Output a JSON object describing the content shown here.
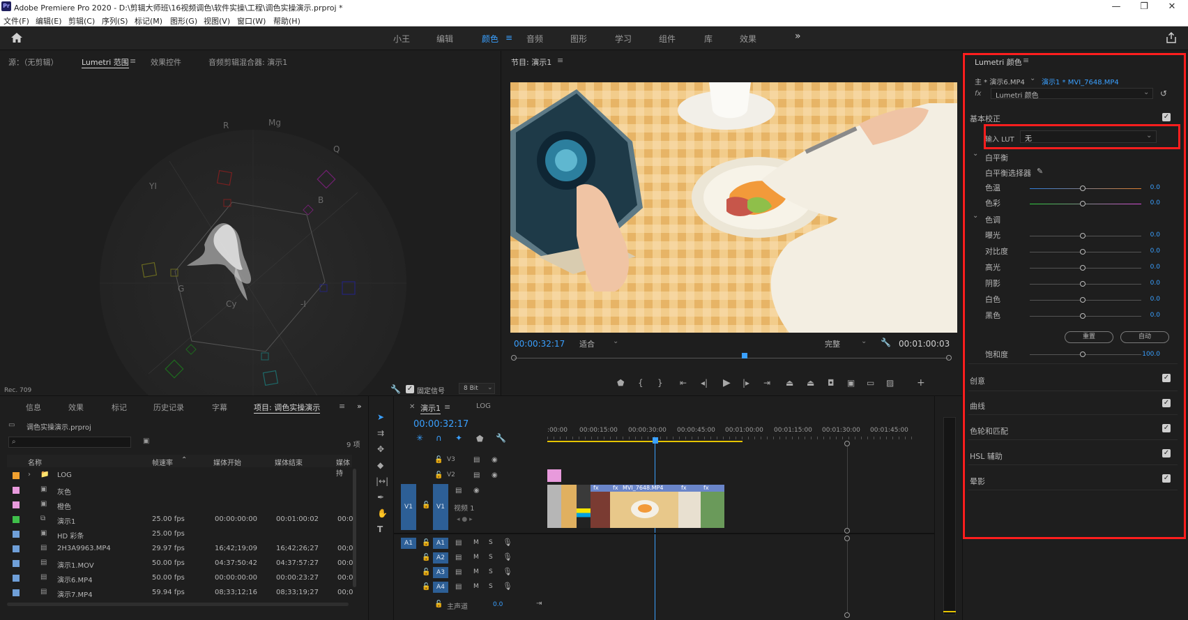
{
  "titlebar": {
    "logo": "Pr",
    "title": "Adobe Premiere Pro 2020 - D:\\剪辑大师班\\16视频调色\\软件实操\\工程\\调色实操演示.prproj *",
    "minimize": "—",
    "restore": "❐",
    "close": "✕"
  },
  "menubar": [
    "文件(F)",
    "编辑(E)",
    "剪辑(C)",
    "序列(S)",
    "标记(M)",
    "图形(G)",
    "视图(V)",
    "窗口(W)",
    "帮助(H)"
  ],
  "workspaces": {
    "items": [
      "小王",
      "编辑",
      "颜色",
      "音频",
      "图形",
      "学习",
      "组件",
      "库",
      "效果"
    ],
    "active": "颜色",
    "more": "»"
  },
  "source_panel": {
    "tabs": [
      "源：（无剪辑）",
      "Lumetri 范围",
      "效果控件",
      "音频剪辑混合器: 演示1"
    ],
    "active_tab": "Lumetri 范围",
    "scope_labels": [
      "R",
      "Mg",
      "Q",
      "YI",
      "B",
      "G",
      "Cy",
      "-I"
    ],
    "rec_label": "Rec. 709",
    "clamp_label": "固定信号",
    "bit_depth": "8 Bit"
  },
  "program_panel": {
    "title": "节目: 演示1",
    "timecode": "00:00:32:17",
    "fit": "适合",
    "quality": "完整",
    "duration": "00:01:00:03",
    "playhead_fraction": 0.53
  },
  "lumetri": {
    "title": "Lumetri 颜色",
    "master": "主 * 演示6.MP4",
    "clip": "演示1 * MVI_7648.MP4",
    "effect": "Lumetri 颜色",
    "basic": {
      "title": "基本校正",
      "lut_label": "输入 LUT",
      "lut_value": "无",
      "white_balance": "白平衡",
      "wb_picker": "白平衡选择器",
      "tone": "色调",
      "reset": "重置",
      "auto": "自动",
      "sliders": [
        {
          "label": "色温",
          "value": "0.0"
        },
        {
          "label": "色彩",
          "value": "0.0"
        },
        {
          "label": "曝光",
          "value": "0.0"
        },
        {
          "label": "对比度",
          "value": "0.0"
        },
        {
          "label": "高光",
          "value": "0.0"
        },
        {
          "label": "阴影",
          "value": "0.0"
        },
        {
          "label": "白色",
          "value": "0.0"
        },
        {
          "label": "黑色",
          "value": "0.0"
        }
      ],
      "saturation": {
        "label": "饱和度",
        "value": "100.0"
      }
    },
    "sections": [
      "创意",
      "曲线",
      "色轮和匹配",
      "HSL 辅助",
      "晕影"
    ]
  },
  "project_panel": {
    "tabs": [
      "信息",
      "效果",
      "标记",
      "历史记录",
      "字幕",
      "项目: 调色实操演示"
    ],
    "active_tab": "项目: 调色实操演示",
    "file": "调色实操演示.prproj",
    "count": "9 项",
    "columns": [
      "名称",
      "帧速率",
      "媒体开始",
      "媒体结束",
      "媒体持"
    ],
    "rows": [
      {
        "color": "#f0a030",
        "name": "LOG",
        "fps": "",
        "start": "",
        "end": "",
        "extra": "",
        "kind": "bin"
      },
      {
        "color": "#e89adc",
        "name": "灰色",
        "fps": "",
        "start": "",
        "end": "",
        "extra": "",
        "kind": "clip"
      },
      {
        "color": "#e89adc",
        "name": "橙色",
        "fps": "",
        "start": "",
        "end": "",
        "extra": "",
        "kind": "clip"
      },
      {
        "color": "#3fbf4a",
        "name": "演示1",
        "fps": "25.00 fps",
        "start": "00:00:00:00",
        "end": "00:01:00:02",
        "extra": "00:0",
        "kind": "seq"
      },
      {
        "color": "#6f9fd8",
        "name": "HD 彩条",
        "fps": "25.00 fps",
        "start": "",
        "end": "",
        "extra": "",
        "kind": "clip"
      },
      {
        "color": "#6f9fd8",
        "name": "2H3A9963.MP4",
        "fps": "29.97 fps",
        "start": "16;42;19;09",
        "end": "16;42;26;27",
        "extra": "00;0",
        "kind": "video"
      },
      {
        "color": "#6f9fd8",
        "name": "演示1.MOV",
        "fps": "50.00 fps",
        "start": "04:37:50:42",
        "end": "04:37:57:27",
        "extra": "00:0",
        "kind": "video"
      },
      {
        "color": "#6f9fd8",
        "name": "演示6.MP4",
        "fps": "50.00 fps",
        "start": "00:00:00:00",
        "end": "00:00:23:27",
        "extra": "00:0",
        "kind": "video"
      },
      {
        "color": "#6f9fd8",
        "name": "演示7.MP4",
        "fps": "59.94 fps",
        "start": "08;33;12;16",
        "end": "08;33;19;27",
        "extra": "00;0",
        "kind": "video"
      }
    ]
  },
  "timeline": {
    "tab": "演示1",
    "tab2": "LOG",
    "timecode": "00:00:32:17",
    "ruler": [
      ":00:00",
      "00:00:15:00",
      "00:00:30:00",
      "00:00:45:00",
      "00:01:00:00",
      "00:01:15:00",
      "00:01:30:00",
      "00:01:45:00"
    ],
    "video_tracks": [
      "V3",
      "V2",
      "V1"
    ],
    "audio_tracks": [
      "A1",
      "A2",
      "A3",
      "A4"
    ],
    "video1_name": "视频 1",
    "master": "主声道",
    "master_value": "0.0",
    "clip_label": "MVI_7648.MP4",
    "fx": "fx",
    "m": "M",
    "s": "S"
  },
  "icons": [
    "home-icon",
    "share-icon",
    "menu-icon",
    "wrench-icon",
    "play-icon",
    "marker-icon",
    "camera-icon",
    "plus-icon",
    "selection-tool-icon",
    "razor-tool-icon",
    "hand-tool-icon",
    "type-tool-icon",
    "eye-icon",
    "lock-icon",
    "mic-icon",
    "eyedropper-icon",
    "reset-icon"
  ]
}
